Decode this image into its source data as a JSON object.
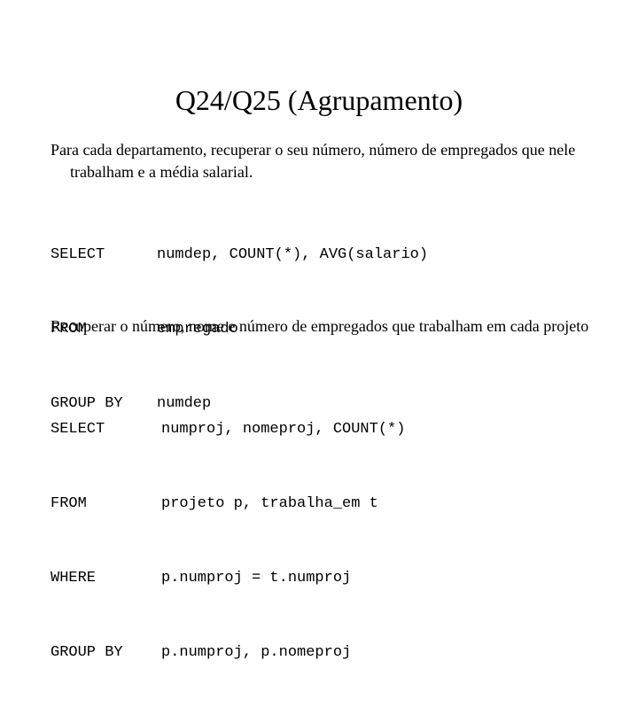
{
  "slide": {
    "title": "Q24/Q25 (Agrupamento)",
    "background_color": "#ffffff",
    "text_color": "#000000"
  },
  "paragraphs": [
    {
      "text": "Para cada departamento, recuperar o seu número, número de empregados que nele trabalham e a média salarial."
    },
    {
      "text": "Recuperar o número, nome e número de empregados que trabalham em cada projeto"
    }
  ],
  "code_blocks": [
    {
      "lines": [
        {
          "keyword": "SELECT",
          "expression": "numdep, COUNT(*), AVG(salario)"
        },
        {
          "keyword": "FROM",
          "expression": "empregado"
        },
        {
          "keyword": "GROUP BY",
          "expression": "numdep"
        }
      ]
    },
    {
      "lines": [
        {
          "keyword": "SELECT",
          "expression": "numproj, nomeproj, COUNT(*)"
        },
        {
          "keyword": "FROM",
          "expression": "projeto p, trabalha_em t"
        },
        {
          "keyword": "WHERE",
          "expression": "p.numproj = t.numproj"
        },
        {
          "keyword": "GROUP BY",
          "expression": "p.numproj, p.nomeproj"
        }
      ]
    }
  ]
}
